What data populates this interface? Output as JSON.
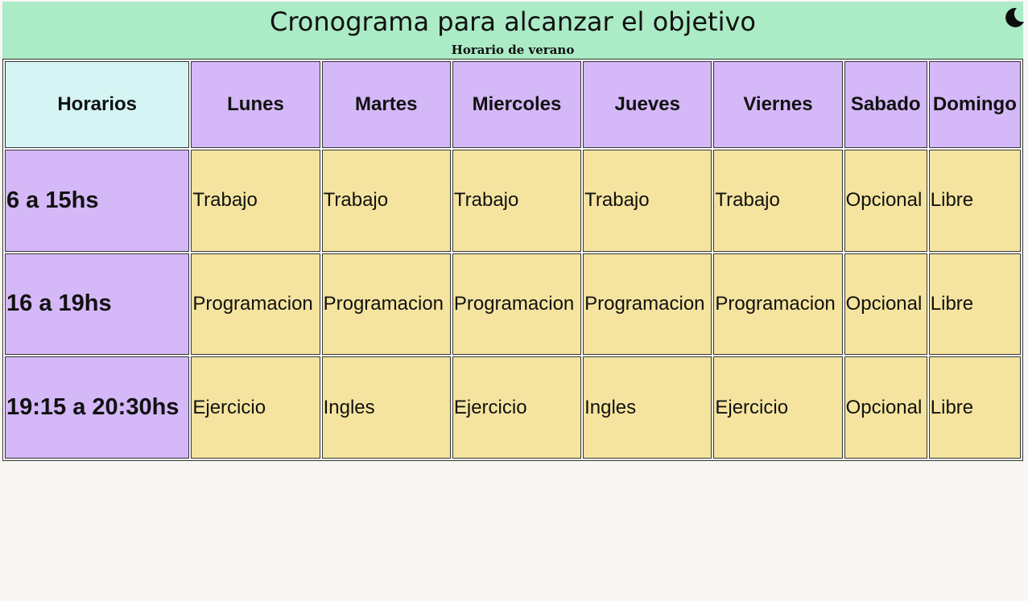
{
  "header": {
    "title": "Cronograma para alcanzar el objetivo",
    "subtitle": "Horario de verano",
    "theme_toggle_icon": "moon-icon"
  },
  "colors": {
    "header_bg": "#abebc6",
    "day_header_bg": "#d4b8f7",
    "corner_bg": "#d4f5f3",
    "slot_bg": "#d4b8f7",
    "cell_bg": "#f5e49f",
    "page_bg": "#f8f7f4"
  },
  "table": {
    "corner_label": "Horarios",
    "days": [
      "Lunes",
      "Martes",
      "Miercoles",
      "Jueves",
      "Viernes",
      "Sabado",
      "Domingo"
    ],
    "rows": [
      {
        "time": "6 a 15hs",
        "cells": [
          "Trabajo",
          "Trabajo",
          "Trabajo",
          "Trabajo",
          "Trabajo",
          "Opcional",
          "Libre"
        ]
      },
      {
        "time": "16 a 19hs",
        "cells": [
          "Programacion",
          "Programacion",
          "Programacion",
          "Programacion",
          "Programacion",
          "Opcional",
          "Libre"
        ]
      },
      {
        "time": "19:15 a 20:30hs",
        "cells": [
          "Ejercicio",
          "Ingles",
          "Ejercicio",
          "Ingles",
          "Ejercicio",
          "Opcional",
          "Libre"
        ]
      }
    ]
  }
}
